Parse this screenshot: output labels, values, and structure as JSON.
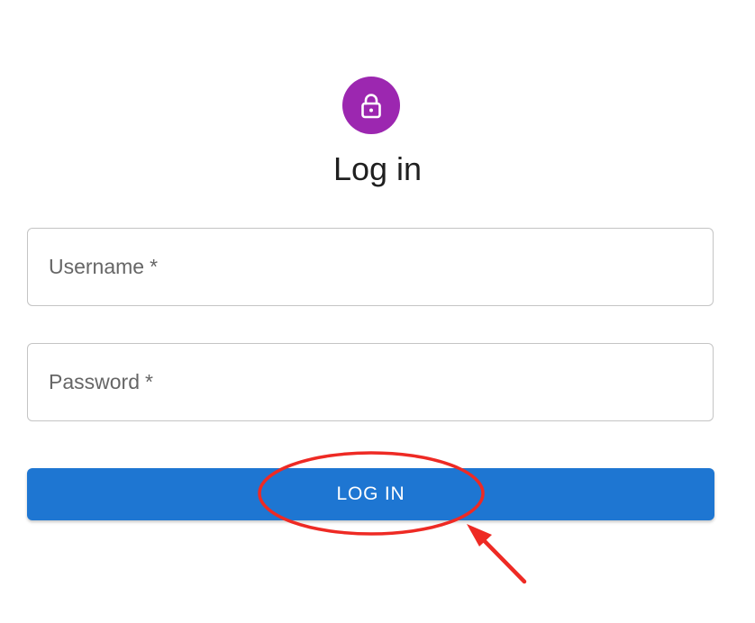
{
  "header": {
    "avatar_icon": "lock-icon",
    "avatar_color": "#9c27b0",
    "title": "Log in"
  },
  "form": {
    "username": {
      "label": "Username",
      "required_mark": "*",
      "value": ""
    },
    "password": {
      "label": "Password",
      "required_mark": "*",
      "value": ""
    },
    "submit_label": "LOG IN",
    "submit_color": "#1e76d2"
  },
  "annotation": {
    "highlight_color": "#ee2a24",
    "shapes": [
      "ellipse-around-login-button",
      "arrow-pointing-at-login-button"
    ]
  }
}
